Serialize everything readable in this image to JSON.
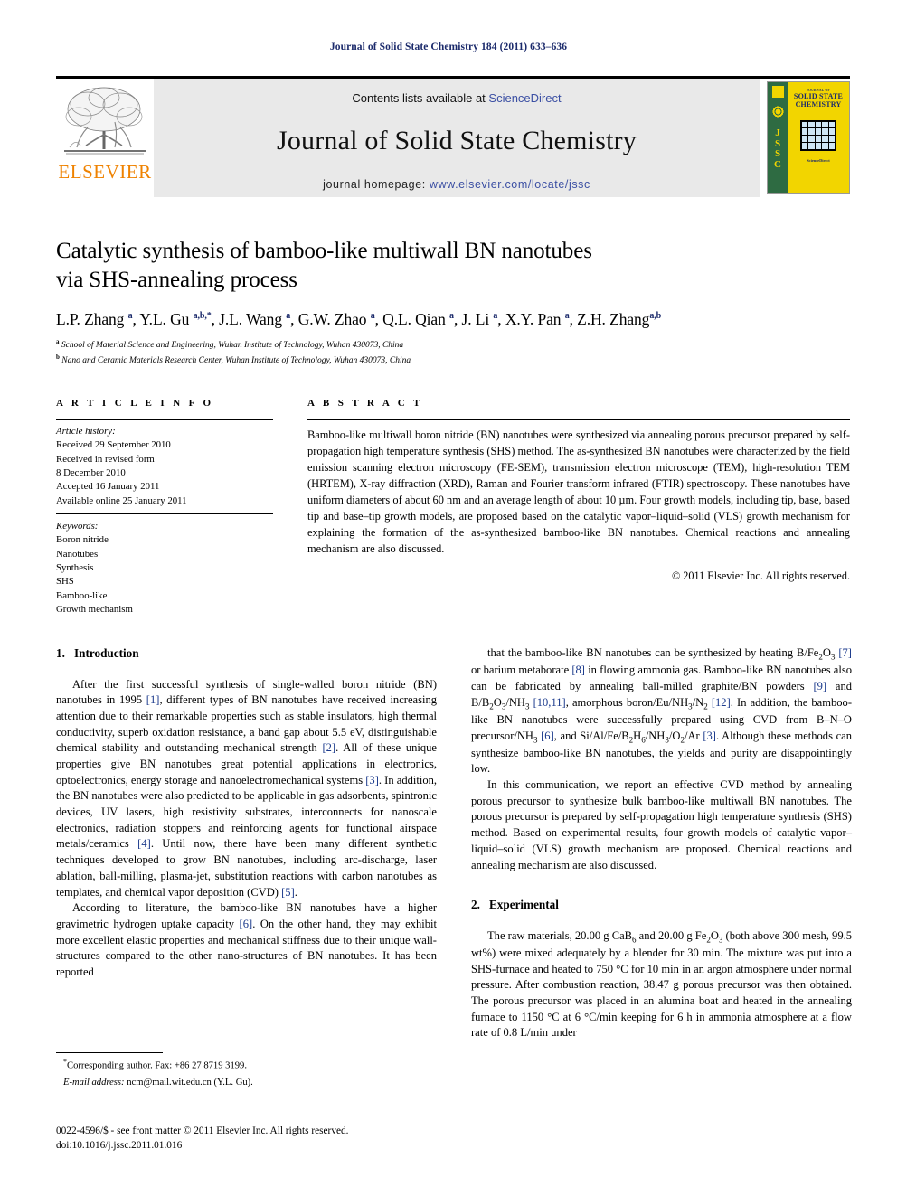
{
  "running_head": "Journal of Solid State Chemistry 184 (2011) 633–636",
  "masthead": {
    "contents_prefix": "Contents lists available at ",
    "sciencedirect": "ScienceDirect",
    "journal_title": "Journal of Solid State Chemistry",
    "homepage_prefix": "journal homepage: ",
    "homepage_url": "www.elsevier.com/locate/jssc",
    "publisher_logo_text": "ELSEVIER",
    "cover": {
      "spine_letters": [
        "J",
        "S",
        "S",
        "C"
      ],
      "front_kicker": "JOURNAL OF",
      "front_title_line1": "SOLID STATE",
      "front_title_line2": "CHEMISTRY",
      "front_footer_brand": "ScienceDirect"
    },
    "accent_link_color": "#3b4fa3",
    "elsevier_orange": "#ef8200",
    "cover_yellow": "#f2d500",
    "cover_green": "#2e6b42"
  },
  "article": {
    "title_line1": "Catalytic synthesis of bamboo-like multiwall BN nanotubes",
    "title_line2": "via SHS-annealing process",
    "authors_html": "L.P. Zhang <sup>a</sup>, Y.L. Gu <sup>a,b,*</sup>, J.L. Wang <sup>a</sup>, G.W. Zhao <sup>a</sup>, Q.L. Qian <sup>a</sup>, J. Li <sup>a</sup>, X.Y. Pan <sup>a</sup>, Z.H. Zhang<sup>a,b</sup>",
    "affiliation_a": "School of Material Science and Engineering, Wuhan Institute of Technology, Wuhan 430073, China",
    "affiliation_b": "Nano and Ceramic Materials Research Center, Wuhan Institute of Technology, Wuhan 430073, China"
  },
  "article_info": {
    "heading": "A R T I C L E   I N F O",
    "history_label": "Article history:",
    "history": [
      "Received 29 September 2010",
      "Received in revised form",
      "8 December 2010",
      "Accepted 16 January 2011",
      "Available online 25 January 2011"
    ],
    "keywords_label": "Keywords:",
    "keywords": [
      "Boron nitride",
      "Nanotubes",
      "Synthesis",
      "SHS",
      "Bamboo-like",
      "Growth mechanism"
    ]
  },
  "abstract": {
    "heading": "A B S T R A C T",
    "text": "Bamboo-like multiwall boron nitride (BN) nanotubes were synthesized via annealing porous precursor prepared by self-propagation high temperature synthesis (SHS) method. The as-synthesized BN nanotubes were characterized by the field emission scanning electron microscopy (FE-SEM), transmission electron microscope (TEM), high-resolution TEM (HRTEM), X-ray diffraction (XRD), Raman and Fourier transform infrared (FTIR) spectroscopy. These nanotubes have uniform diameters of about 60 nm and an average length of about 10 µm. Four growth models, including tip, base, based tip and base–tip growth models, are proposed based on the catalytic vapor–liquid–solid (VLS) growth mechanism for explaining the formation of the as-synthesized bamboo-like BN nanotubes. Chemical reactions and annealing mechanism are also discussed.",
    "copyright": "© 2011 Elsevier Inc. All rights reserved."
  },
  "sections": {
    "intro_num": "1.",
    "intro_title": "Introduction",
    "exp_num": "2.",
    "exp_title": "Experimental"
  },
  "body": {
    "left_p1_html": "After the first successful synthesis of single-walled boron nitride (BN) nanotubes in 1995 <span class=\"ref\">[1]</span>, different types of BN nanotubes have received increasing attention due to their remarkable properties such as stable insulators, high thermal conductivity, superb oxidation resistance, a band gap about 5.5 eV, distinguishable chemical stability and outstanding mechanical strength <span class=\"ref\">[2]</span>. All of these unique properties give BN nanotubes great potential applications in electronics, optoelectronics, energy storage and nanoelectromechanical systems <span class=\"ref\">[3]</span>. In addition, the BN nanotubes were also predicted to be applicable in gas adsorbents, spintronic devices, UV lasers, high resistivity substrates, interconnects for nanoscale electronics, radiation stoppers and reinforcing agents for functional airspace metals/ceramics <span class=\"ref\">[4]</span>. Until now, there have been many different synthetic techniques developed to grow BN nanotubes, including arc-discharge, laser ablation, ball-milling, plasma-jet, substitution reactions with carbon nanotubes as templates, and chemical vapor deposition (CVD) <span class=\"ref\">[5]</span>.",
    "left_p2_html": "According to literature, the bamboo-like BN nanotubes have a higher gravimetric hydrogen uptake capacity <span class=\"ref\">[6]</span>. On the other hand, they may exhibit more excellent elastic properties and mechanical stiffness due to their unique wall-structures compared to the other nano-structures of BN nanotubes. It has been reported",
    "right_p1_html": "that the bamboo-like BN nanotubes can be synthesized by heating B/Fe<sub>2</sub>O<sub>3</sub> <span class=\"ref\">[7]</span> or barium metaborate <span class=\"ref\">[8]</span> in flowing ammonia gas. Bamboo-like BN nanotubes also can be fabricated by annealing ball-milled graphite/BN powders <span class=\"ref\">[9]</span> and B/B<sub>2</sub>O<sub>3</sub>/NH<sub>3</sub> <span class=\"ref\">[10,11]</span>, amorphous boron/Eu/NH<sub>3</sub>/N<sub>2</sub> <span class=\"ref\">[12]</span>. In addition, the bamboo-like BN nanotubes were successfully prepared using CVD from B–N–O precursor/NH<sub>3</sub> <span class=\"ref\">[6]</span>, and Si/Al/Fe/B<sub>2</sub>H<sub>6</sub>/NH<sub>3</sub>/O<sub>2</sub>/Ar <span class=\"ref\">[3]</span>. Although these methods can synthesize bamboo-like BN nanotubes, the yields and purity are disappointingly low.",
    "right_p2_html": "In this communication, we report an effective CVD method by annealing porous precursor to synthesize bulk bamboo-like multiwall BN nanotubes. The porous precursor is prepared by self-propagation high temperature synthesis (SHS) method. Based on experimental results, four growth models of catalytic vapor–liquid–solid (VLS) growth mechanism are proposed. Chemical reactions and annealing mechanism are also discussed.",
    "right_p3_html": "The raw materials, 20.00 g CaB<sub>6</sub> and 20.00 g Fe<sub>2</sub>O<sub>3</sub> (both above 300 mesh, 99.5 wt%) were mixed adequately by a blender for 30 min. The mixture was put into a SHS-furnace and heated to 750 °C for 10 min in an argon atmosphere under normal pressure. After combustion reaction, 38.47 g porous precursor was then obtained. The porous precursor was placed in an alumina boat and heated in the annealing furnace to 1150 °C at 6 °C/min keeping for 6 h in ammonia atmosphere at a flow rate of 0.8 L/min under"
  },
  "footnotes": {
    "corresponding_html": "<sup>*</sup>Corresponding author. Fax: +86 27 8719 3199.",
    "email_html": "<span class=\"em\">E-mail address:</span> ncm@mail.wit.edu.cn (Y.L. Gu).",
    "issn_line1_html": "0022-4596/$ - see front matter © 2011 Elsevier Inc. All rights reserved.",
    "issn_line2_html": "doi:10.1016/j.jssc.2011.01.016"
  }
}
